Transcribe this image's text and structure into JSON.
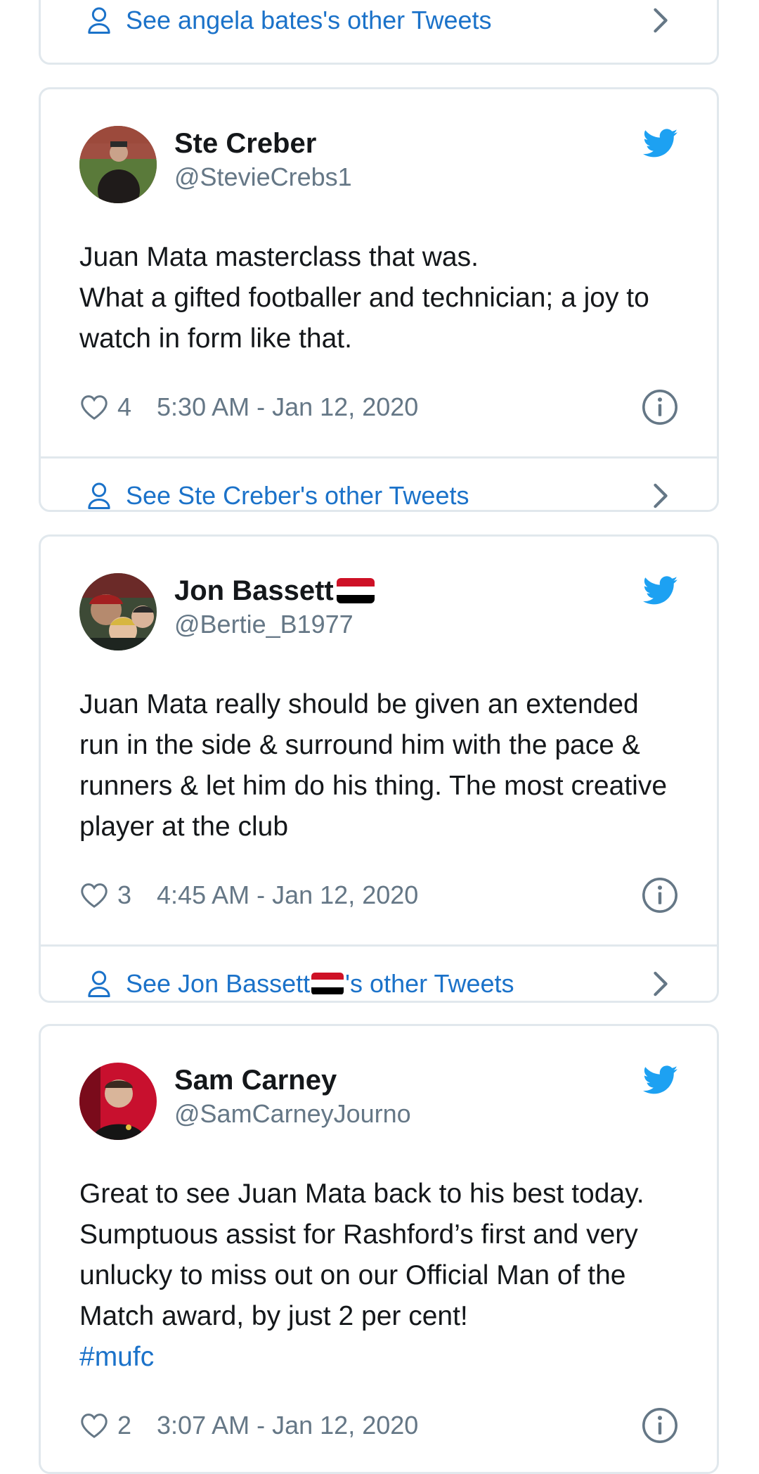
{
  "top_card": {
    "see_more_label": "See angela bates's other Tweets"
  },
  "tweets": [
    {
      "name": "Ste Creber",
      "handle": "@StevieCrebs1",
      "text": "Juan Mata masterclass that was.\nWhat a gifted footballer and technician; a joy to watch in form like that.",
      "likes": "4",
      "time": "5:30 AM - Jan 12, 2020",
      "see_more_label": "See Ste Creber's other Tweets"
    },
    {
      "name": "Jon Bassett",
      "handle": "@Bertie_B1977",
      "text": "Juan Mata really should be given an extended run in the side & surround him with the pace & runners & let him do his thing. The most creative player at the club",
      "likes": "3",
      "time": "4:45 AM - Jan 12, 2020",
      "see_more_prefix": "See Jon Bassett",
      "see_more_suffix": "'s other Tweets"
    },
    {
      "name": "Sam Carney",
      "handle": "@SamCarneyJourno",
      "text": "Great to see Juan Mata back to his best today. Sumptuous assist for Rashford’s first and very unlucky to miss out on our Official Man of the Match award, by just 2 per cent!",
      "hashtag": "#mufc",
      "likes": "2",
      "time": "3:07 AM - Jan 12, 2020"
    }
  ],
  "colors": {
    "twitter_blue": "#1da1f2",
    "link_blue": "#1b72c9",
    "secondary_text": "#657786",
    "border": "#e1e8ed",
    "flag_red": "#ce1126",
    "flag_white": "#ffffff",
    "flag_black": "#000000"
  },
  "icons": {
    "brand": "twitter-bird-icon",
    "like": "heart-icon",
    "info": "info-icon",
    "profile": "person-icon",
    "navigate": "chevron-right-icon",
    "flag": "flag-emoji-icon"
  }
}
